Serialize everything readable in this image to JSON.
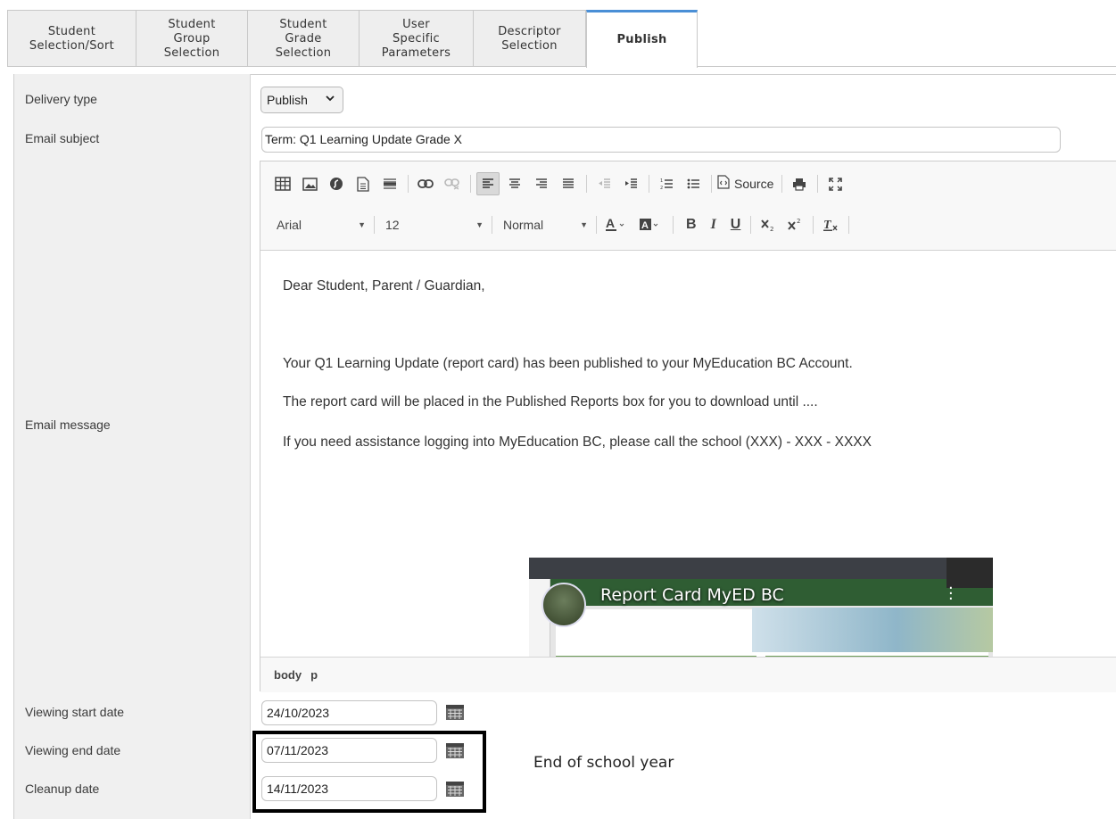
{
  "tabs": [
    {
      "label": "Student\nSelection/Sort",
      "active": false
    },
    {
      "label": "Student\nGroup\nSelection",
      "active": false
    },
    {
      "label": "Student\nGrade\nSelection",
      "active": false
    },
    {
      "label": "User\nSpecific\nParameters",
      "active": false
    },
    {
      "label": "Descriptor\nSelection",
      "active": false
    },
    {
      "label": "Publish",
      "active": true
    }
  ],
  "form": {
    "delivery_type_label": "Delivery type",
    "delivery_type_value": "Publish",
    "email_subject_label": "Email subject",
    "email_subject_value": "Term: Q1 Learning Update Grade X",
    "email_message_label": "Email message",
    "viewing_start_label": "Viewing start date",
    "viewing_start_value": "24/10/2023",
    "viewing_end_label": "Viewing end date",
    "viewing_end_value": "07/11/2023",
    "cleanup_label": "Cleanup date",
    "cleanup_value": "14/11/2023"
  },
  "editor": {
    "source_label": "Source",
    "font_name": "Arial",
    "font_size": "12",
    "paragraph_format": "Normal",
    "bold_label": "B",
    "italic_label": "I",
    "underline_label": "U",
    "paragraphs": [
      "Dear Student, Parent / Guardian,",
      "Your Q1 Learning Update (report card) has been published to your MyEducation BC Account.",
      "The report card will be placed in the Published Reports box for you to download until ....",
      "If you need assistance logging into MyEducation BC, please call the school (XXX) - XXX - XXXX"
    ],
    "video_title": "Report Card MyED BC",
    "status_path": [
      "body",
      "p"
    ]
  },
  "annotation_note": "End of school year",
  "colors": {
    "active_tab_accent": "#4a8fd6",
    "label_column_bg": "#f0f0f0",
    "youtube_red": "#ff0000",
    "highlight_border": "#000000"
  }
}
